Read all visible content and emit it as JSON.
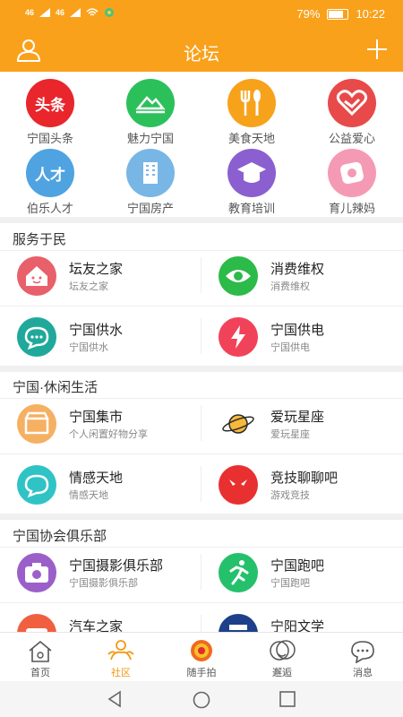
{
  "status": {
    "signal1": "46",
    "signal2": "46",
    "battery": "79%",
    "time": "10:22",
    "battery_level": 0.79
  },
  "header": {
    "title": "论坛"
  },
  "grid": [
    {
      "label": "宁国头条",
      "icon": "toutiao-icon",
      "color": "#e8262c",
      "text": "头条"
    },
    {
      "label": "魅力宁国",
      "icon": "landscape-icon",
      "color": "#2cc05b"
    },
    {
      "label": "美食天地",
      "icon": "fork-spoon-icon",
      "color": "#f7a21b"
    },
    {
      "label": "公益爱心",
      "icon": "heart-icon",
      "color": "#e84a4a"
    },
    {
      "label": "伯乐人才",
      "icon": "talent-icon",
      "color": "#4fa3e0",
      "text": "人才"
    },
    {
      "label": "宁国房产",
      "icon": "building-icon",
      "color": "#78b6e6"
    },
    {
      "label": "教育培训",
      "icon": "graduation-cap-icon",
      "color": "#8b5fcf"
    },
    {
      "label": "育儿辣妈",
      "icon": "baby-icon",
      "color": "#f59ab5"
    }
  ],
  "sections": [
    {
      "title": "服务于民",
      "items": [
        {
          "title": "坛友之家",
          "sub": "坛友之家",
          "icon": "house-icon",
          "color": "#e8606a"
        },
        {
          "title": "消费维权",
          "sub": "消费维权",
          "icon": "eye-icon",
          "color": "#2cba49"
        },
        {
          "title": "宁国供水",
          "sub": "宁国供水",
          "icon": "chat-icon",
          "color": "#20a99a"
        },
        {
          "title": "宁国供电",
          "sub": "宁国供电",
          "icon": "lightning-icon",
          "color": "#f0435a"
        }
      ]
    },
    {
      "title": "宁国·休闲生活",
      "items": [
        {
          "title": "宁国集市",
          "sub": "个人闲置好物分享",
          "icon": "shop-icon",
          "color": "#f5b062"
        },
        {
          "title": "爱玩星座",
          "sub": "爱玩星座",
          "icon": "planet-icon",
          "color": "#f0a030"
        },
        {
          "title": "情感天地",
          "sub": "情感天地",
          "icon": "chat-bubble-icon",
          "color": "#30c3c6"
        },
        {
          "title": "竞技聊聊吧",
          "sub": "游戏竞技",
          "icon": "game-mask-icon",
          "color": "#e83030"
        }
      ]
    },
    {
      "title": "宁国协会俱乐部",
      "items": [
        {
          "title": "宁国摄影俱乐部",
          "sub": "宁国摄影俱乐部",
          "icon": "camera-icon",
          "color": "#9b5fc9"
        },
        {
          "title": "宁国跑吧",
          "sub": "宁国跑吧",
          "icon": "runner-icon",
          "color": "#25c06c"
        },
        {
          "title": "汽车之家",
          "sub": "",
          "icon": "car-icon",
          "color": "#f06040"
        },
        {
          "title": "宁阳文学",
          "sub": "",
          "icon": "book-icon",
          "color": "#1e3f8a"
        }
      ]
    }
  ],
  "tabs": [
    {
      "label": "首页",
      "icon": "home-icon"
    },
    {
      "label": "社区",
      "icon": "community-icon",
      "active": true
    },
    {
      "label": "随手拍",
      "icon": "snapshot-icon"
    },
    {
      "label": "邂逅",
      "icon": "encounter-icon"
    },
    {
      "label": "消息",
      "icon": "message-icon"
    }
  ]
}
